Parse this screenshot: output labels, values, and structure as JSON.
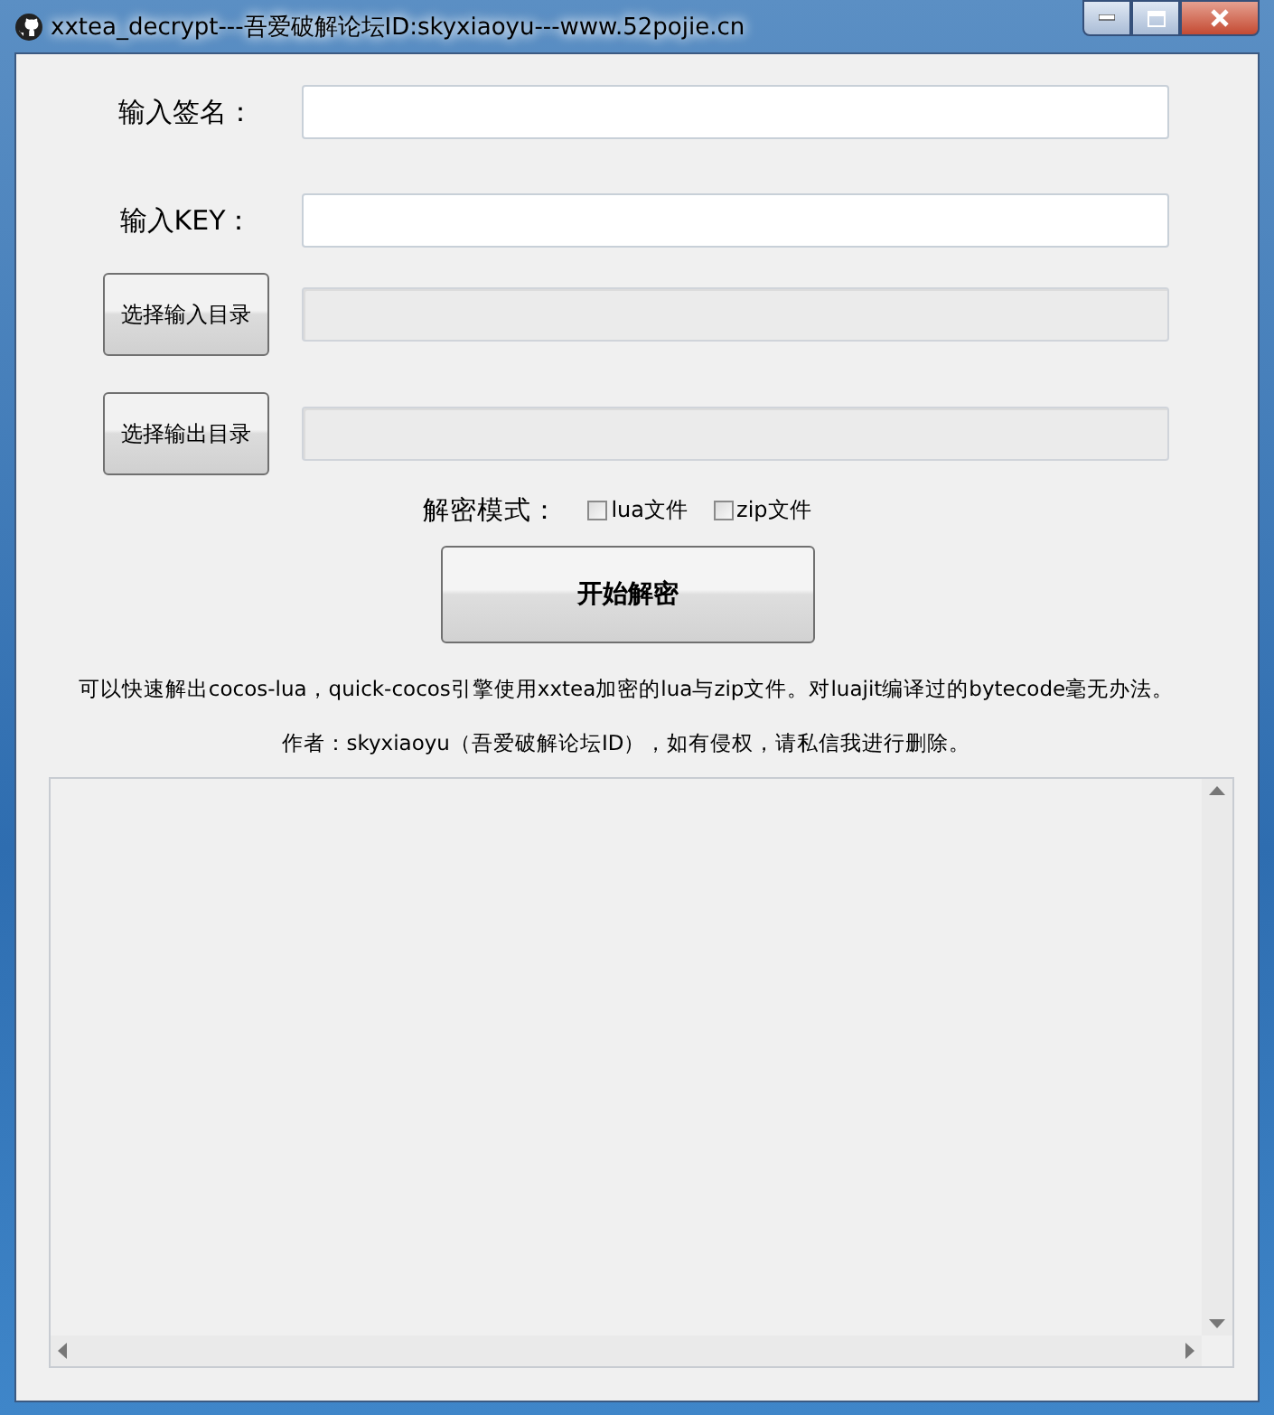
{
  "window": {
    "title": "xxtea_decrypt---吾爱破解论坛ID:skyxiaoyu---www.52pojie.cn"
  },
  "fields": [
    {
      "kind": "label",
      "label": "输入签名：",
      "disabled": false
    },
    {
      "kind": "label",
      "label": "输入KEY：",
      "disabled": false
    },
    {
      "kind": "button",
      "label": "选择输入目录",
      "disabled": true
    },
    {
      "kind": "button",
      "label": "选择输出目录",
      "disabled": true
    }
  ],
  "mode": {
    "label": "解密模式：",
    "options": [
      {
        "label": "lua文件",
        "checked": false
      },
      {
        "label": "zip文件",
        "checked": false
      }
    ]
  },
  "start_button": "开始解密",
  "notes": [
    "可以快速解出cocos-lua，quick-cocos引擎使用xxtea加密的lua与zip文件。对luajit编译过的bytecode毫无办法。",
    "作者：skyxiaoyu（吾爱破解论坛ID），如有侵权，请私信我进行删除。"
  ]
}
